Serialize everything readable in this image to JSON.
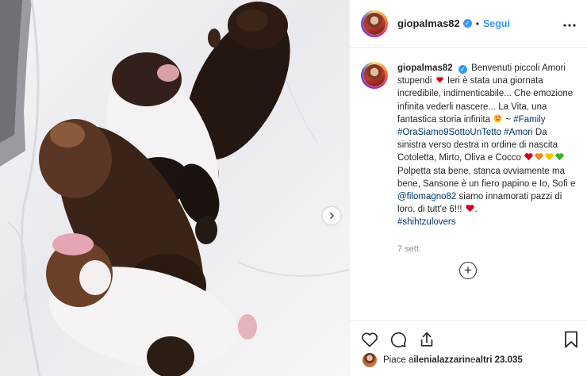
{
  "post": {
    "username": "giopalmas82",
    "follow_label": "Segui",
    "separator": "•",
    "more_label": "•••",
    "next_label": "›"
  },
  "caption": {
    "username": "giopalmas82",
    "part1": "Benvenuti piccoli Amori stupendi ",
    "part2": " Ieri è stata una giornata incredibile, indimenticabile... Che emozione infinita vederli nascere... La Vita, una fantastica storia infinita ",
    "part3": " ~ ",
    "hashtag1": "#Family",
    "hashtag2": "#OraSiamo9SottoUnTetto",
    "hashtag3": "#Amori",
    "part4": " Da sinistra verso destra in ordine di nascita Cotoletta, Mirto, Oliva e Cocco ",
    "part5": " Polpetta sta bene, stanca ovviamente ma bene, Sansone è un fiero papino e Io, Sofi e ",
    "mention": "@filomagno82",
    "part6": " siamo innamorati pazzi di loro, di tutt'e 6!!! ",
    "part7": ".",
    "hashtag4": "#shihtzulovers"
  },
  "time": "7 sett.",
  "add_comment_label": "+",
  "likes": {
    "prefix": "Piace a ",
    "user": "ilenialazzarin",
    "middle": " e ",
    "others": "altri 23.035"
  },
  "colors": {
    "accent": "#3897f0",
    "hashtag": "#003569",
    "heart_red": "#e0245e",
    "muted": "#8e8e8e"
  },
  "icons": [
    "verified-badge-icon",
    "heart-emoji-icon",
    "heart-eyes-emoji-icon",
    "red-heart-icon",
    "orange-heart-icon",
    "yellow-heart-icon",
    "green-heart-icon",
    "like-heart-icon",
    "comment-icon",
    "share-icon",
    "bookmark-icon",
    "add-comment-icon",
    "chevron-right-icon"
  ]
}
